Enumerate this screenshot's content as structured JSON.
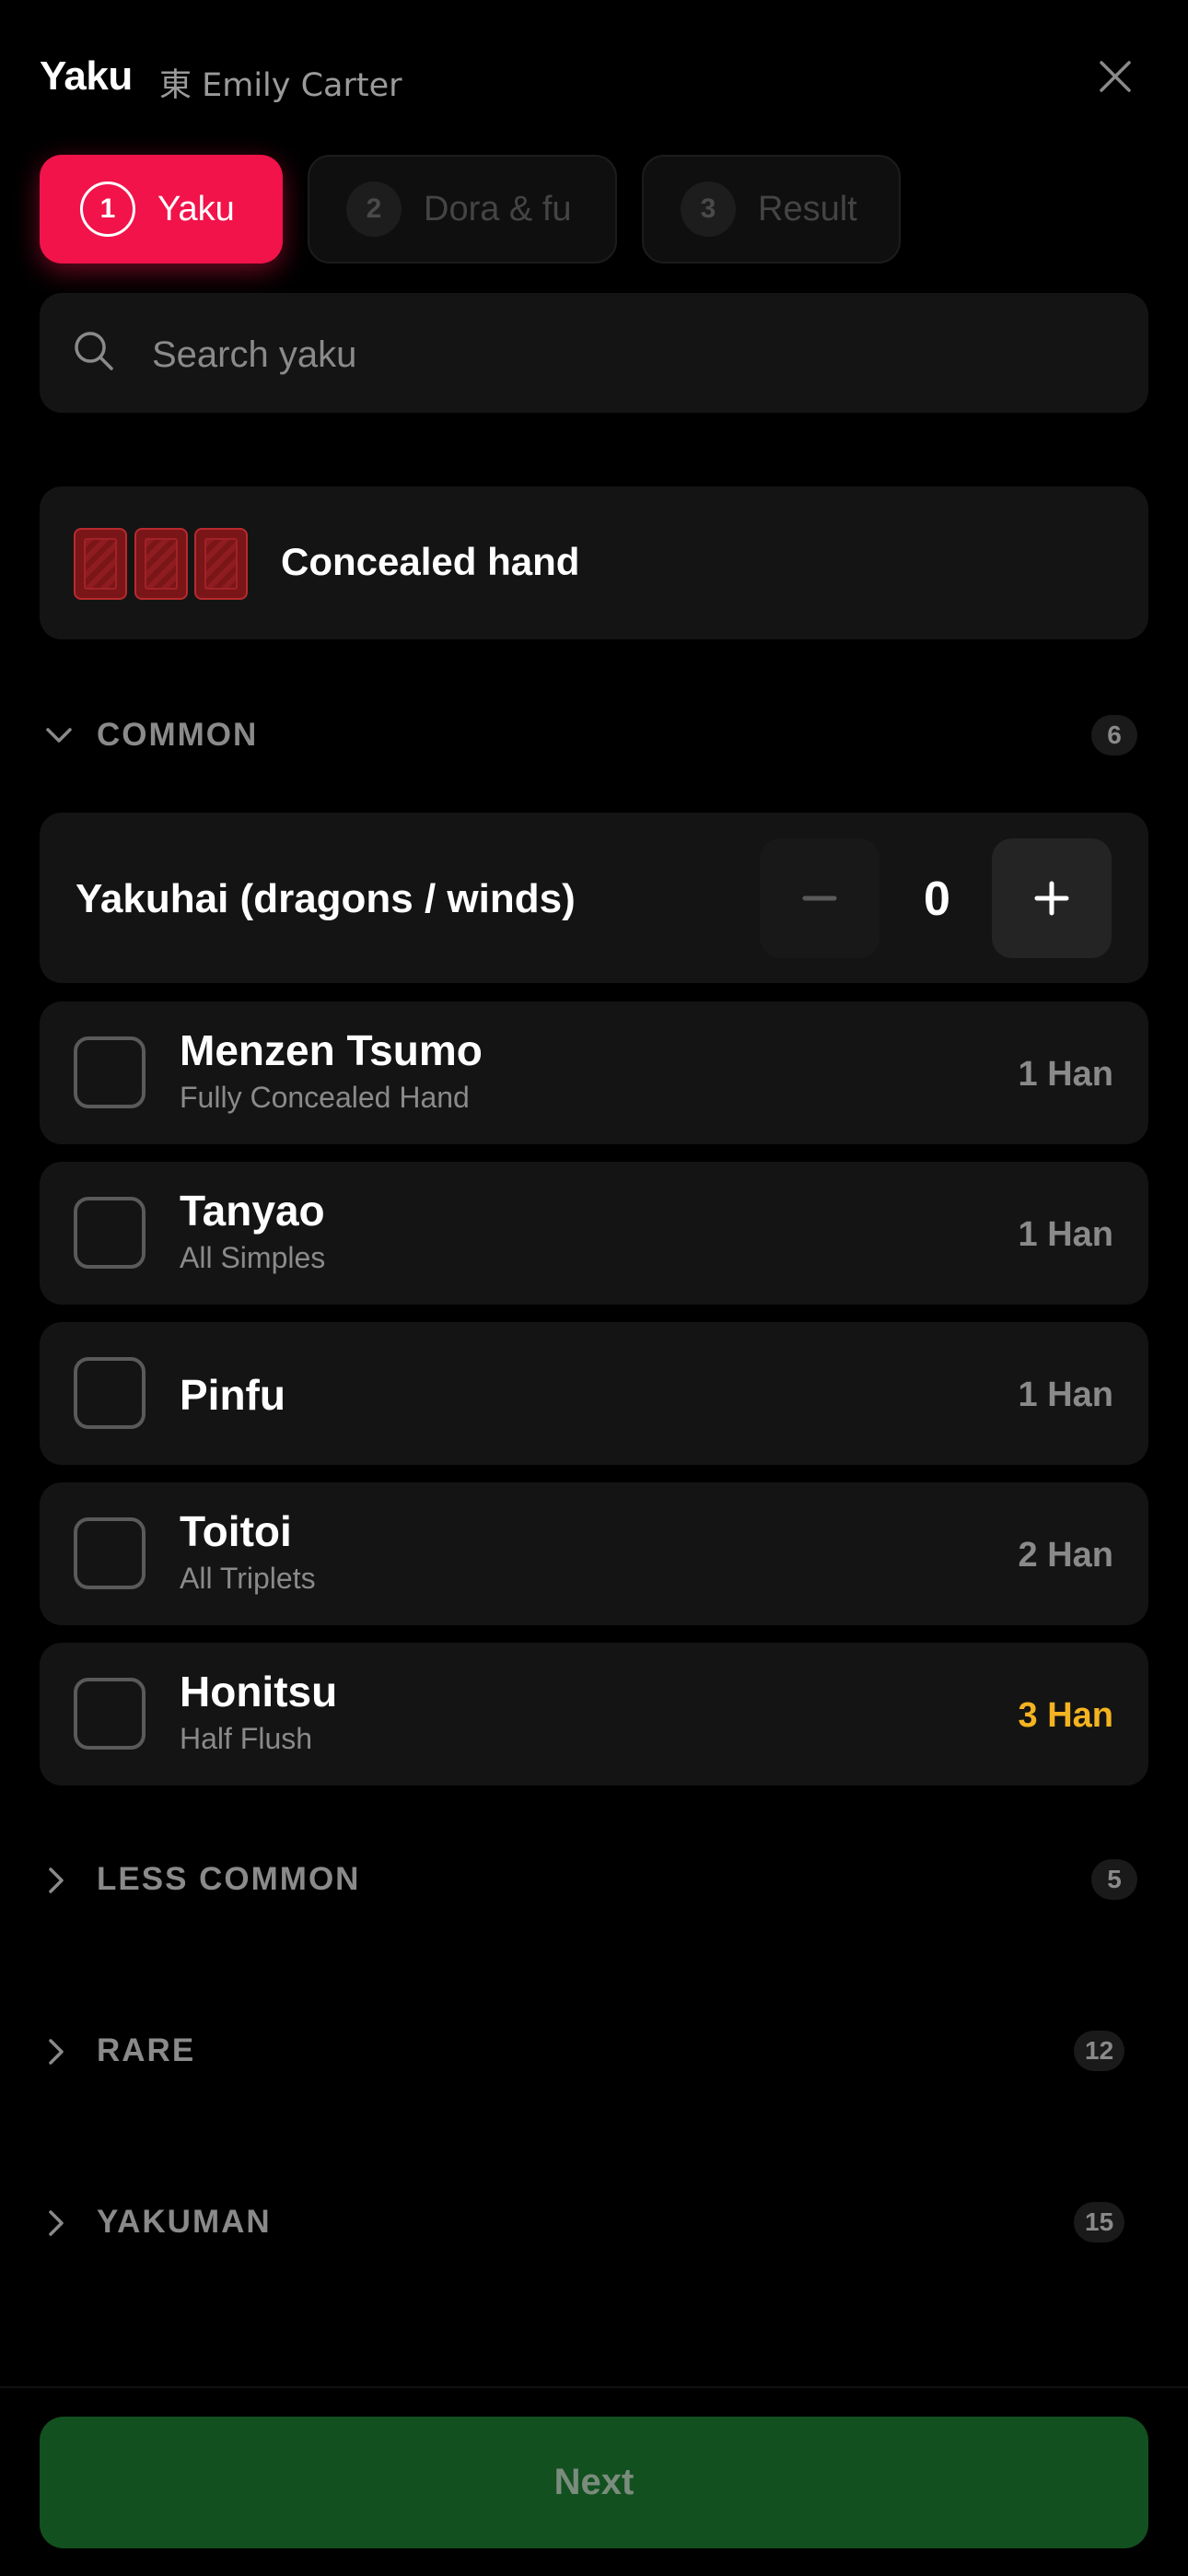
{
  "header": {
    "title": "Yaku",
    "subtitle": "東 Emily Carter",
    "close_icon": "close-icon"
  },
  "steps": [
    {
      "number": "1",
      "label": "Yaku",
      "active": true
    },
    {
      "number": "2",
      "label": "Dora & fu",
      "active": false
    },
    {
      "number": "3",
      "label": "Result",
      "active": false
    }
  ],
  "search": {
    "placeholder": "Search yaku",
    "value": "",
    "icon": "search-icon"
  },
  "concealed": {
    "label": "Concealed hand",
    "icon": "mahjong-tiles-icon"
  },
  "sections": {
    "common": {
      "label": "COMMON",
      "count": "6",
      "expanded": true
    },
    "less_common": {
      "label": "LESS COMMON",
      "count": "5",
      "expanded": false
    },
    "rare": {
      "label": "RARE",
      "count": "12",
      "expanded": false
    },
    "yakuman": {
      "label": "YAKUMAN",
      "count": "15",
      "expanded": false
    }
  },
  "yakuhai": {
    "label": "Yakuhai (dragons / winds)",
    "value": "0",
    "minus_label": "−",
    "plus_label": "+"
  },
  "yaku": [
    {
      "name": "Menzen Tsumo",
      "sub": "Fully Concealed Hand",
      "han": "1 Han",
      "checked": false
    },
    {
      "name": "Tanyao",
      "sub": "All Simples",
      "han": "1 Han",
      "checked": false
    },
    {
      "name": "Pinfu",
      "sub": "",
      "han": "1 Han",
      "checked": false
    },
    {
      "name": "Toitoi",
      "sub": "All Triplets",
      "han": "2 Han",
      "checked": false
    },
    {
      "name": "Honitsu",
      "sub": "Half Flush",
      "han": "3 Han",
      "checked": false
    }
  ],
  "colors": {
    "accent": "#f1134a",
    "highlight_han": "#f4b321",
    "next_button": "#13501f"
  },
  "footer": {
    "next_label": "Next"
  }
}
